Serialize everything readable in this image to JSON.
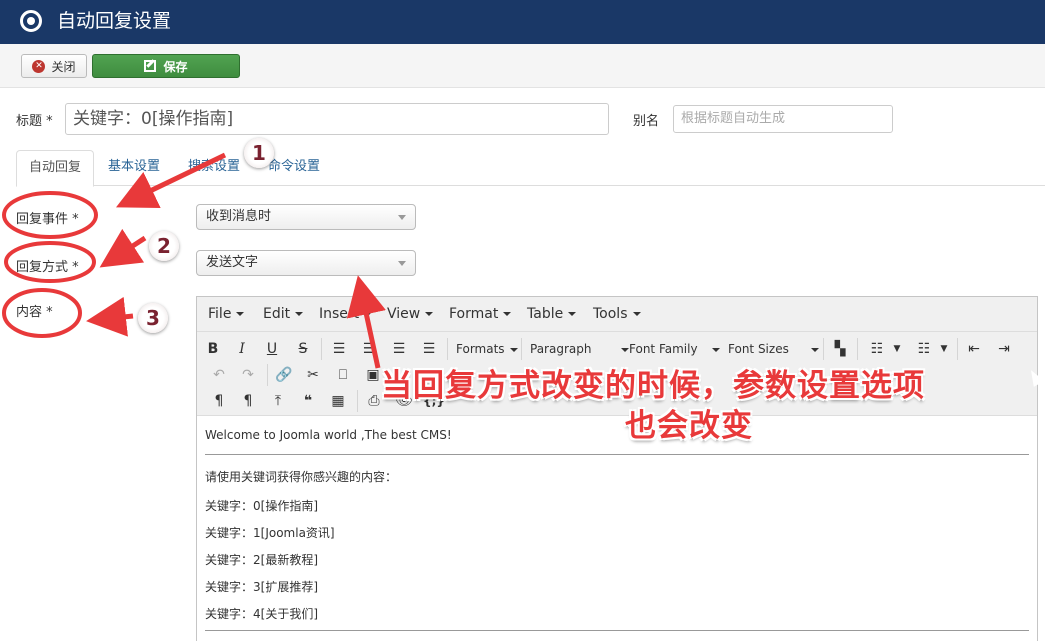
{
  "header": {
    "title": "自动回复设置",
    "icon": "joomla-target-icon"
  },
  "toolbar": {
    "close_label": "关闭",
    "save_label": "保存"
  },
  "form": {
    "title_label": "标题 *",
    "title_value": "关键字：0[操作指南]",
    "alias_label": "别名",
    "alias_placeholder": "根据标题自动生成"
  },
  "tabs": [
    {
      "label": "自动回复",
      "active": true
    },
    {
      "label": "基本设置",
      "active": false
    },
    {
      "label": "搜索设置",
      "active": false
    },
    {
      "label": "命令设置",
      "active": false
    }
  ],
  "fields": {
    "event_label": "回复事件 *",
    "event_value": "收到消息时",
    "mode_label": "回复方式 *",
    "mode_value": "发送文字",
    "content_label": "内容 *"
  },
  "editor": {
    "menus": [
      "File",
      "Edit",
      "Insert",
      "View",
      "Format",
      "Table",
      "Tools"
    ],
    "dropdowns": [
      "Formats",
      "Paragraph",
      "Font Family",
      "Font Sizes"
    ],
    "content": {
      "intro": "Welcome to Joomla world ,The best CMS!",
      "prompt": "请使用关键词获得你感兴趣的内容：",
      "keywords": [
        "关键字：0[操作指南]",
        "关键字：1[Joomla资讯]",
        "关键字：2[最新教程]",
        "关键字：3[扩展推荐]",
        "关键字：4[关于我们]"
      ]
    }
  },
  "annotations": {
    "badges": [
      "1",
      "2",
      "3"
    ],
    "caption_line1": "当回复方式改变的时候，参数设置选项",
    "caption_line2": "也会改变",
    "color": "#e8393a"
  }
}
